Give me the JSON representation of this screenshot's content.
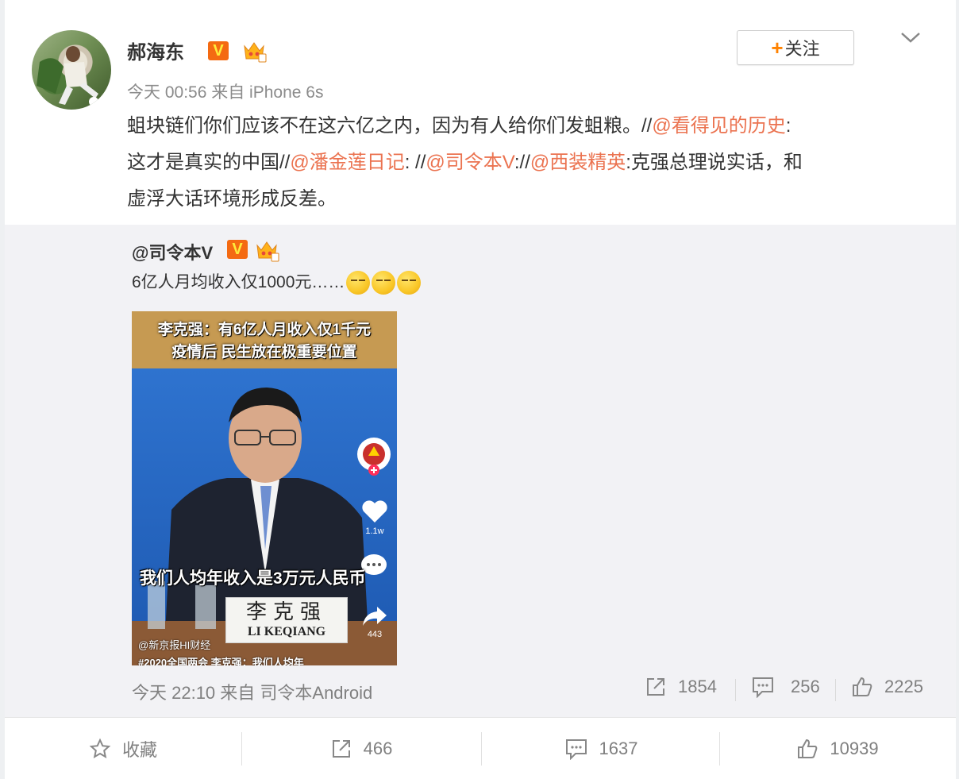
{
  "post": {
    "username": "郝海东",
    "meta": "今天 00:56 来自 iPhone 6s",
    "follow_label": "关注",
    "content_parts": [
      "蛆块链们你们应该不在这六亿之内，因为有人给你们发蛆粮。//",
      "@看得见的历史",
      ":",
      "这才是真实的中国//",
      "@潘金莲日记",
      ": //",
      "@司令本V",
      "://",
      "@西装精英",
      ":克强总理说实话，和",
      "虚浮大话环境形成反差。"
    ]
  },
  "repost": {
    "user": "@司令本V",
    "text": "6亿人月均收入仅1000元……",
    "video": {
      "headline_line1": "李克强：有6亿人月收入仅1千元",
      "headline_line2": "疫情后 民生放在极重要位置",
      "caption": "我们人均年收入是3万元人民币",
      "nameplate_cn": "李克强",
      "nameplate_en": "LI KEQIANG",
      "source": "@新京报HI财经",
      "hashtag": "#2020全国两会 李克强：我们人均年",
      "likes": "1.1w",
      "shares": "443"
    },
    "footer_time": "今天 22:10 来自 司令本Android",
    "reposts": "1854",
    "comments": "256",
    "likes": "2225"
  },
  "actions": {
    "favorite": "收藏",
    "reposts": "466",
    "comments": "1637",
    "likes": "10939"
  },
  "colors": {
    "mention": "#eb7350",
    "accent_orange": "#ff8200",
    "vip_badge": "#f46a12"
  }
}
